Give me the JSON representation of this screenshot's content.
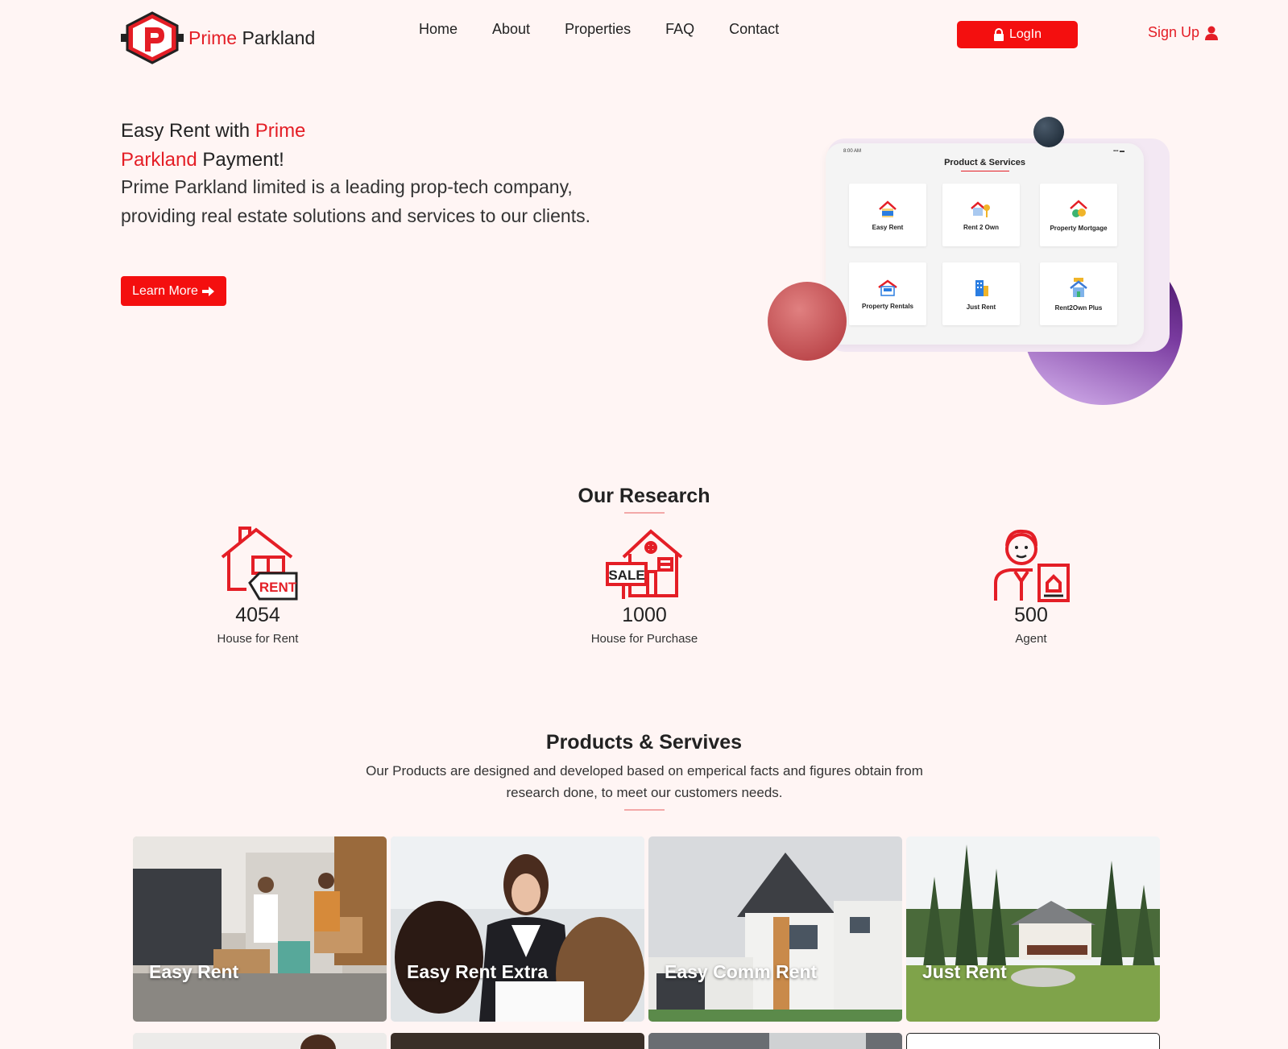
{
  "header": {
    "logo_text_1": "Prime",
    "logo_text_2": "Parkland",
    "nav": [
      "Home",
      "About",
      "Properties",
      "FAQ",
      "Contact"
    ],
    "login_label": "LogIn",
    "signup_label": "Sign Up"
  },
  "hero": {
    "line1_a": "Easy Rent with ",
    "line1_b": "Prime",
    "line2_a": "Parkland",
    "line2_b": " Payment!",
    "description": "Prime Parkland limited is a leading prop-tech company, providing real estate solutions and services to our clients.",
    "cta_label": "Learn More"
  },
  "illustration": {
    "time": "8:00 AM",
    "title": "Product & Services",
    "tiles": [
      "Easy Rent",
      "Rent 2 Own",
      "Property Mortgage",
      "Property Rentals",
      "Just Rent",
      "Rent2Own Plus"
    ]
  },
  "research": {
    "title": "Our Research",
    "stats": [
      {
        "value": "4054",
        "label": "House for Rent",
        "icon": "rent-house-icon"
      },
      {
        "value": "1000",
        "label": "House for Purchase",
        "icon": "sale-house-icon"
      },
      {
        "value": "500",
        "label": "Agent",
        "icon": "agent-icon"
      }
    ]
  },
  "products": {
    "title": "Products & Servives",
    "description": "Our Products are designed and developed based on emperical facts and figures obtain from research done, to meet our customers needs.",
    "cards": [
      "Easy Rent",
      "Easy Rent Extra",
      "Easy Comm Rent",
      "Just Rent"
    ]
  },
  "colors": {
    "accent": "#f40f0f",
    "brand_red": "#e41e26",
    "background": "#fff5f4"
  }
}
